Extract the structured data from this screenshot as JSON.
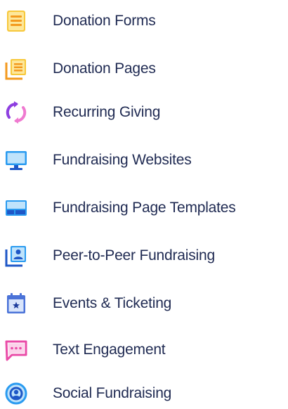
{
  "colors": {
    "text": "#1f2a52",
    "yellow": "#f7c83b",
    "orange": "#f39a1e",
    "purple": "#8e3fe0",
    "pink": "#ef7ad0",
    "blue": "#2a9bf0",
    "navy": "#1e57c7",
    "magenta": "#ea4ca8"
  },
  "menu": {
    "items": [
      {
        "label": "Donation Forms",
        "icon": "form-icon"
      },
      {
        "label": "Donation Pages",
        "icon": "pages-icon"
      },
      {
        "label": "Recurring Giving",
        "icon": "recurring-icon"
      },
      {
        "label": "Fundraising Websites",
        "icon": "monitor-icon"
      },
      {
        "label": "Fundraising Page Templates",
        "icon": "template-icon"
      },
      {
        "label": "Peer-to-Peer Fundraising",
        "icon": "person-icon"
      },
      {
        "label": "Events & Ticketing",
        "icon": "calendar-icon"
      },
      {
        "label": "Text Engagement",
        "icon": "chat-icon"
      },
      {
        "label": "Social Fundraising",
        "icon": "social-icon"
      }
    ]
  }
}
